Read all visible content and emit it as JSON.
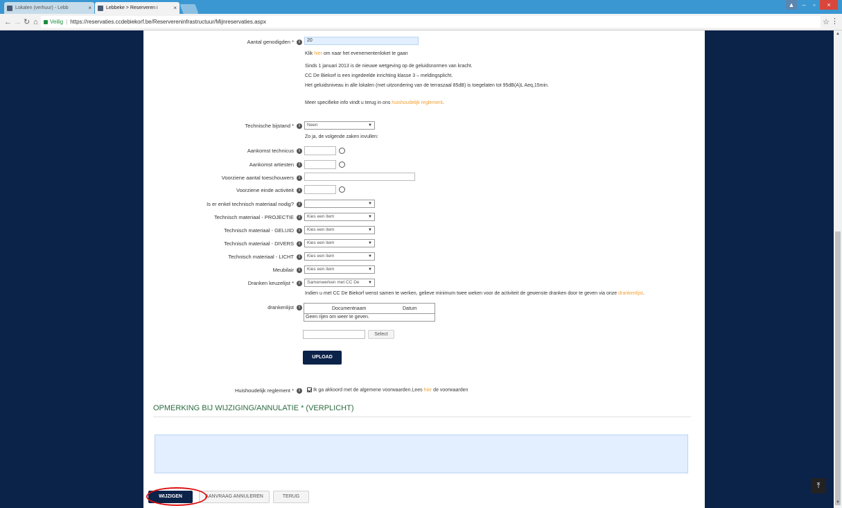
{
  "browser": {
    "tabs": [
      {
        "label": "Lokalen (verhuur) - Lebb"
      },
      {
        "label": "Lebbeke > Reserveren i"
      }
    ],
    "url_secure_label": "Veilig",
    "url": "https://reservaties.ccdebiekorf.be/Reservereninfrastructuur/Mijnreservaties.aspx"
  },
  "form": {
    "guests": {
      "label": "Aantal genodigden *",
      "value": "20"
    },
    "event_link": {
      "prefix": "Klik ",
      "link": "hier",
      "suffix": " om naar het evenementenloket te gaan"
    },
    "noise_info": [
      "Sinds 1 januari 2013 is de nieuwe wetgeving op de geluidsnormen van kracht.",
      "CC De Biekorf is een ingedeelde inrichting klasse 3 – meldingsplicht.",
      "Het geluidsniveau in alle lokalen (met uitzondering van de terraszaal 85dB) is toegelaten tot 95dB(A)L Aeq,15min."
    ],
    "more_info": {
      "prefix": "Meer specifieke info vindt u terug in ons ",
      "link": "huishoudelijk reglement",
      "suffix": "."
    },
    "technical_help": {
      "label": "Technische bijstand *",
      "value": "Neen"
    },
    "if_yes": "Zo ja, de volgende zaken invullen:",
    "technician_arrival": {
      "label": "Aankomst technicus"
    },
    "artists_arrival": {
      "label": "Aankomst artiesten"
    },
    "spectators": {
      "label": "Voorziene aantal toeschouwers"
    },
    "end_activity": {
      "label": "Voorziene einde activiteit"
    },
    "only_technical": {
      "label": "Is er enkel technisch materiaal nodig?",
      "value": ""
    },
    "projection": {
      "label": "Technisch materiaal - PROJECTIE",
      "value": "Kies een item"
    },
    "sound": {
      "label": "Technisch materiaal - GELUID",
      "value": "Kies een item"
    },
    "misc": {
      "label": "Technisch materiaal - DIVERS",
      "value": "Kies een item"
    },
    "light": {
      "label": "Technisch materiaal - LICHT",
      "value": "Kies een item"
    },
    "furniture": {
      "label": "Meubilair",
      "value": "Kies een item"
    },
    "drinks": {
      "label": "Dranken keuzelijst *",
      "value": "Samenwerken met CC De"
    },
    "drinks_note": {
      "prefix": "Indien u met CC De Biekorf wenst samen te werken, gelieve minimum twee weken voor de activiteit de gewenste dranken door te geven via onze ",
      "link": "drankenlijst",
      "suffix": "."
    },
    "drinklist": {
      "label": "drankenlijst",
      "columns": [
        "Documentnaam",
        "Datum"
      ],
      "empty": "Geen rijen om weer te geven."
    },
    "select_button": "Select",
    "upload_button": "UPLOAD",
    "house_rules": {
      "label": "Huishoudelijk reglement *",
      "prefix": "Ik ga akkoord met de algemene voorwaarden.Lees ",
      "link": "hier",
      "suffix": " de voorwaarden"
    }
  },
  "remark_section": {
    "title": "OPMERKING BIJ WIJZIGING/ANNULATIE * (VERPLICHT)"
  },
  "actions": {
    "change": "WIJZIGEN",
    "cancel": "AANVRAAG ANNULEREN",
    "back": "TERUG"
  },
  "colors": {
    "accent": "#0b2249",
    "link": "#f0a030",
    "section": "#2b6a3e",
    "highlight": "#d11111"
  },
  "icons": {
    "info": "i",
    "to_top": "⤒"
  }
}
